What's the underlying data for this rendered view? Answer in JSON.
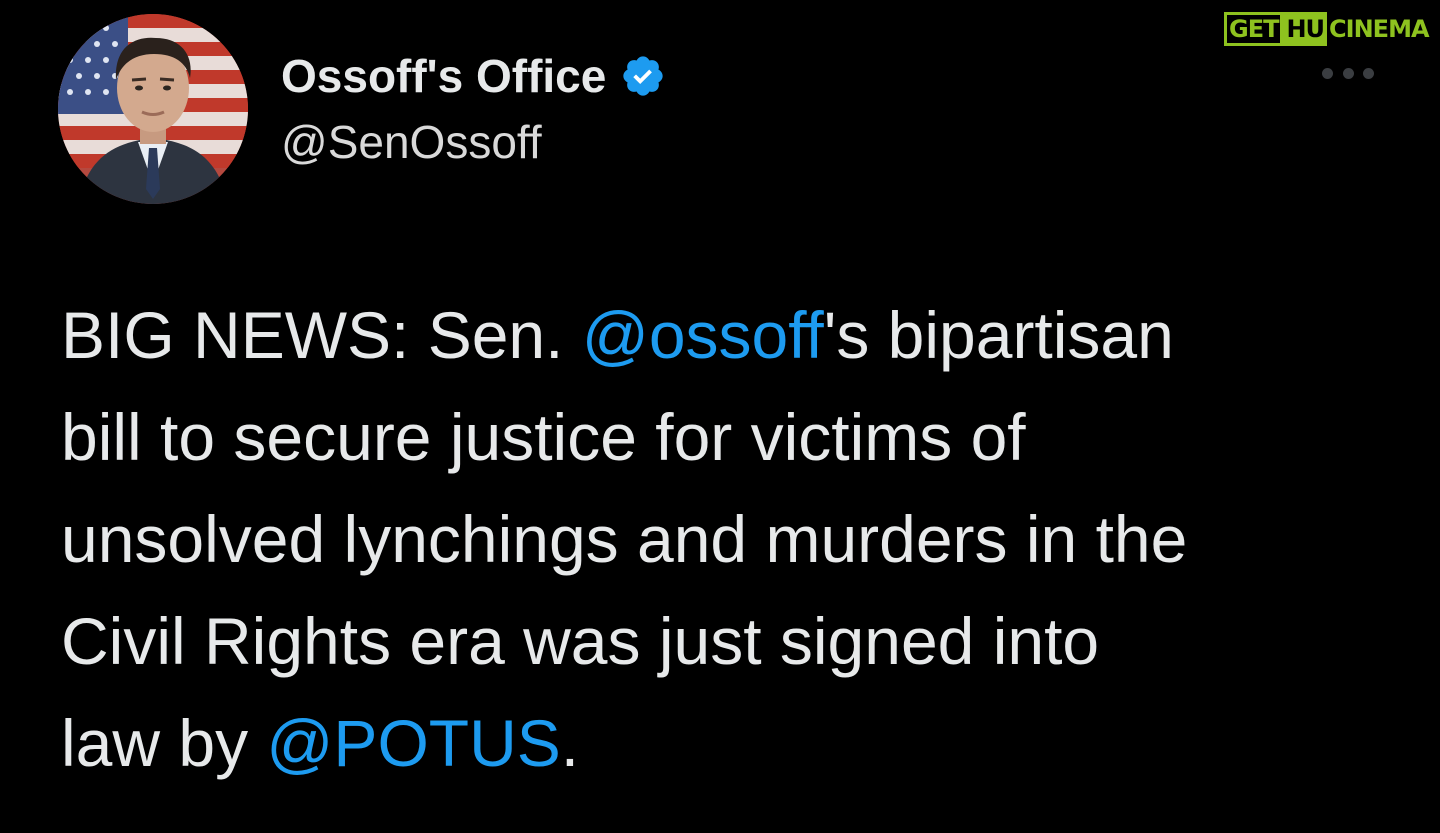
{
  "watermark": {
    "part1": "GET",
    "part2": "HU",
    "part3": "CINEMA"
  },
  "tweet": {
    "display_name": "Ossoff's Office",
    "handle": "@SenOssoff",
    "verified_icon": "verified-badge-icon",
    "more_icon": "more-options-icon",
    "body_lines": [
      {
        "before": "BIG NEWS: Sen. ",
        "mention": "@ossoff",
        "after": "'s bipartisan"
      },
      {
        "before": "bill to secure justice for victims of",
        "mention": "",
        "after": ""
      },
      {
        "before": "unsolved lynchings and murders in the",
        "mention": "",
        "after": ""
      },
      {
        "before": "Civil Rights era was just signed into",
        "mention": "",
        "after": ""
      },
      {
        "before": "law by ",
        "mention": "@POTUS",
        "after": "."
      }
    ]
  },
  "colors": {
    "background": "#000000",
    "text": "#e7e9ea",
    "mention": "#1d9bf0",
    "verified": "#1d9bf0",
    "watermark": "#8ec21f"
  }
}
